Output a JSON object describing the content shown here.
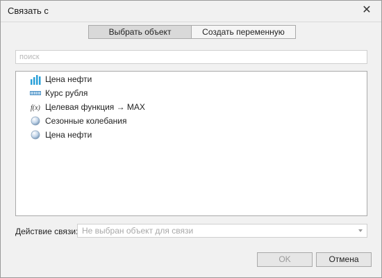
{
  "dialog": {
    "title": "Связать с",
    "close_icon": "close-icon"
  },
  "mode_tabs": [
    {
      "label": "Выбрать объект",
      "active": true
    },
    {
      "label": "Создать переменную",
      "active": false
    }
  ],
  "search": {
    "placeholder": "поиск",
    "value": ""
  },
  "objects": [
    {
      "label": "Цена нефти",
      "icon": "bar-chart-icon"
    },
    {
      "label": "Курс рубля",
      "icon": "series-icon"
    },
    {
      "label": "Целевая функция → MAX",
      "icon": "function-icon"
    },
    {
      "label": "Сезонные колебания",
      "icon": "sphere-icon"
    },
    {
      "label": "Цена нефти",
      "icon": "sphere-icon"
    }
  ],
  "action": {
    "label": "Действие связи:",
    "placeholder": "Не выбран объект для связи",
    "dropdown_icon": "chevron-down-icon"
  },
  "buttons": {
    "ok": "OK",
    "cancel": "Отмена",
    "ok_enabled": false
  },
  "colors": {
    "icon_blue": "#2aa0d8",
    "accent_gray": "#d9d9d9"
  }
}
